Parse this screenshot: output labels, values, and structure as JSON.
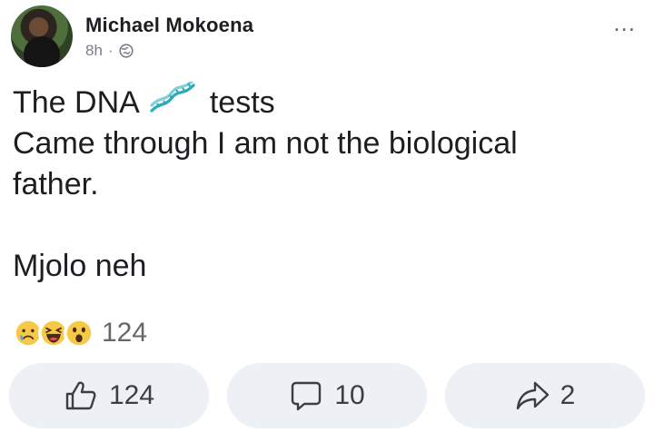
{
  "post": {
    "author": "Michael Mokoena",
    "time": "8h",
    "separator": "·",
    "more_label": "...",
    "text": {
      "line1_before": "The DNA",
      "line1_after": "tests",
      "line2": "Came through I am not the biological",
      "line3": "father.",
      "line4": "Mjolo neh"
    },
    "reactions": {
      "types": [
        "sad-emoji",
        "haha-emoji",
        "wow-emoji"
      ],
      "count": "124"
    },
    "actions": {
      "like_count": "124",
      "comment_count": "10",
      "share_count": "2"
    }
  },
  "colors": {
    "action_bg": "#edf0f4",
    "meta_gray": "#7a7d82",
    "dna_teal": "#2fa9b7"
  }
}
